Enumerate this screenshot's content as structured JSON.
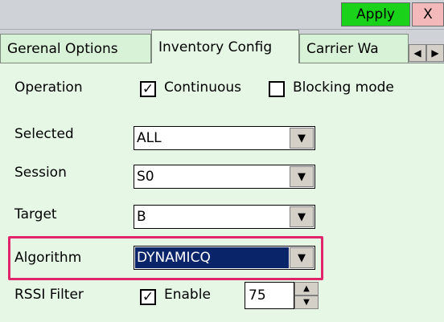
{
  "toolbar": {
    "apply_label": "Apply",
    "close_label": "X",
    "apply_color": "#19d219",
    "close_color": "#f3b9ba"
  },
  "tabs": [
    {
      "label": "Gerenal Options",
      "active": false
    },
    {
      "label": "Inventory Config",
      "active": true
    },
    {
      "label": "Carrier Wa",
      "active": false
    }
  ],
  "tab_scroll": {
    "left_icon": "◀",
    "right_icon": "▶"
  },
  "form": {
    "operation": {
      "label": "Operation",
      "continuous": {
        "label": "Continuous",
        "checked": true
      },
      "blocking": {
        "label": "Blocking mode",
        "checked": false
      }
    },
    "selected": {
      "label": "Selected",
      "value": "ALL"
    },
    "session": {
      "label": "Session",
      "value": "S0"
    },
    "target": {
      "label": "Target",
      "value": "B"
    },
    "algorithm": {
      "label": "Algorithm",
      "value": "DYNAMICQ",
      "highlight_color": "#e0256a"
    },
    "rssi": {
      "label": "RSSI Filter",
      "enable": {
        "label": "Enable",
        "checked": true
      },
      "value": "75"
    }
  },
  "glyphs": {
    "check": "✓",
    "dropdown": "▼",
    "spin_up": "▲",
    "spin_down": "▼"
  }
}
